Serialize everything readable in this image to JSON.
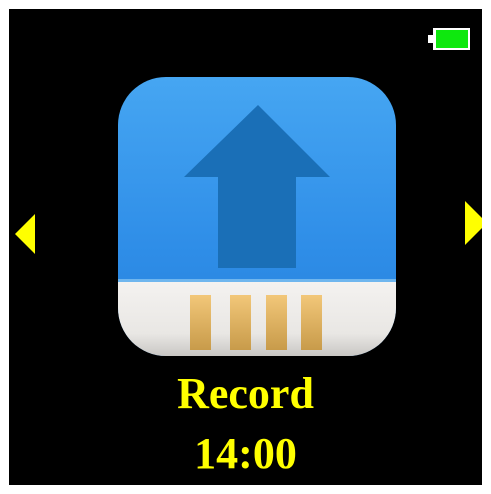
{
  "device_screen": {
    "background": "#000000",
    "battery": {
      "icon": "battery-icon",
      "level": 0.9,
      "fill_color": "#0ee80e"
    },
    "navigation": {
      "prev_icon": "triangle-left-icon",
      "next_icon": "triangle-right-icon",
      "color": "#ffff00"
    },
    "app": {
      "icon": "upload-storage-icon",
      "name": "Record",
      "time": "14:00",
      "text_color": "#ffff00"
    }
  }
}
